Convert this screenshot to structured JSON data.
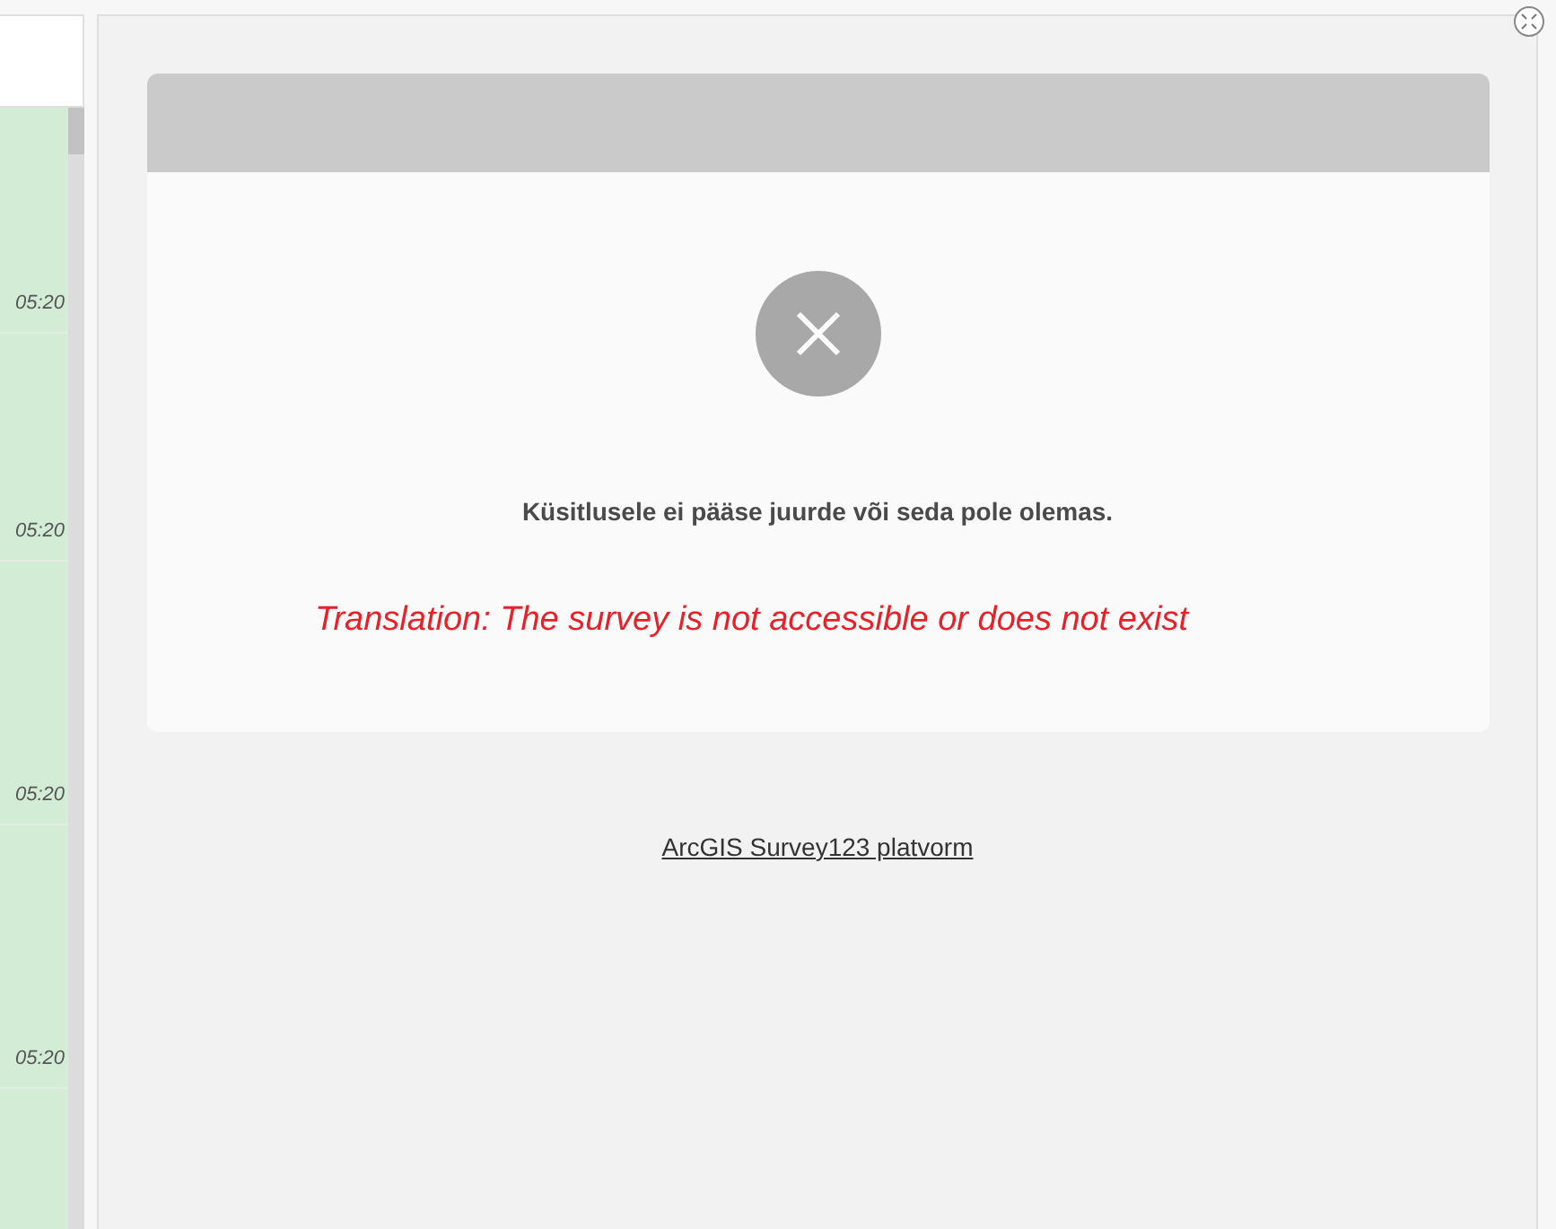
{
  "list": {
    "rows": [
      {
        "time": "05:20"
      },
      {
        "time": "05:20"
      },
      {
        "time": "05:20"
      },
      {
        "time": "05:20"
      }
    ]
  },
  "dialog": {
    "message": "Küsitlusele ei pääse juurde või seda pole olemas.",
    "translation": "Translation: The survey is not accessible or does not exist"
  },
  "link": "ArcGIS Survey123 platvorm"
}
